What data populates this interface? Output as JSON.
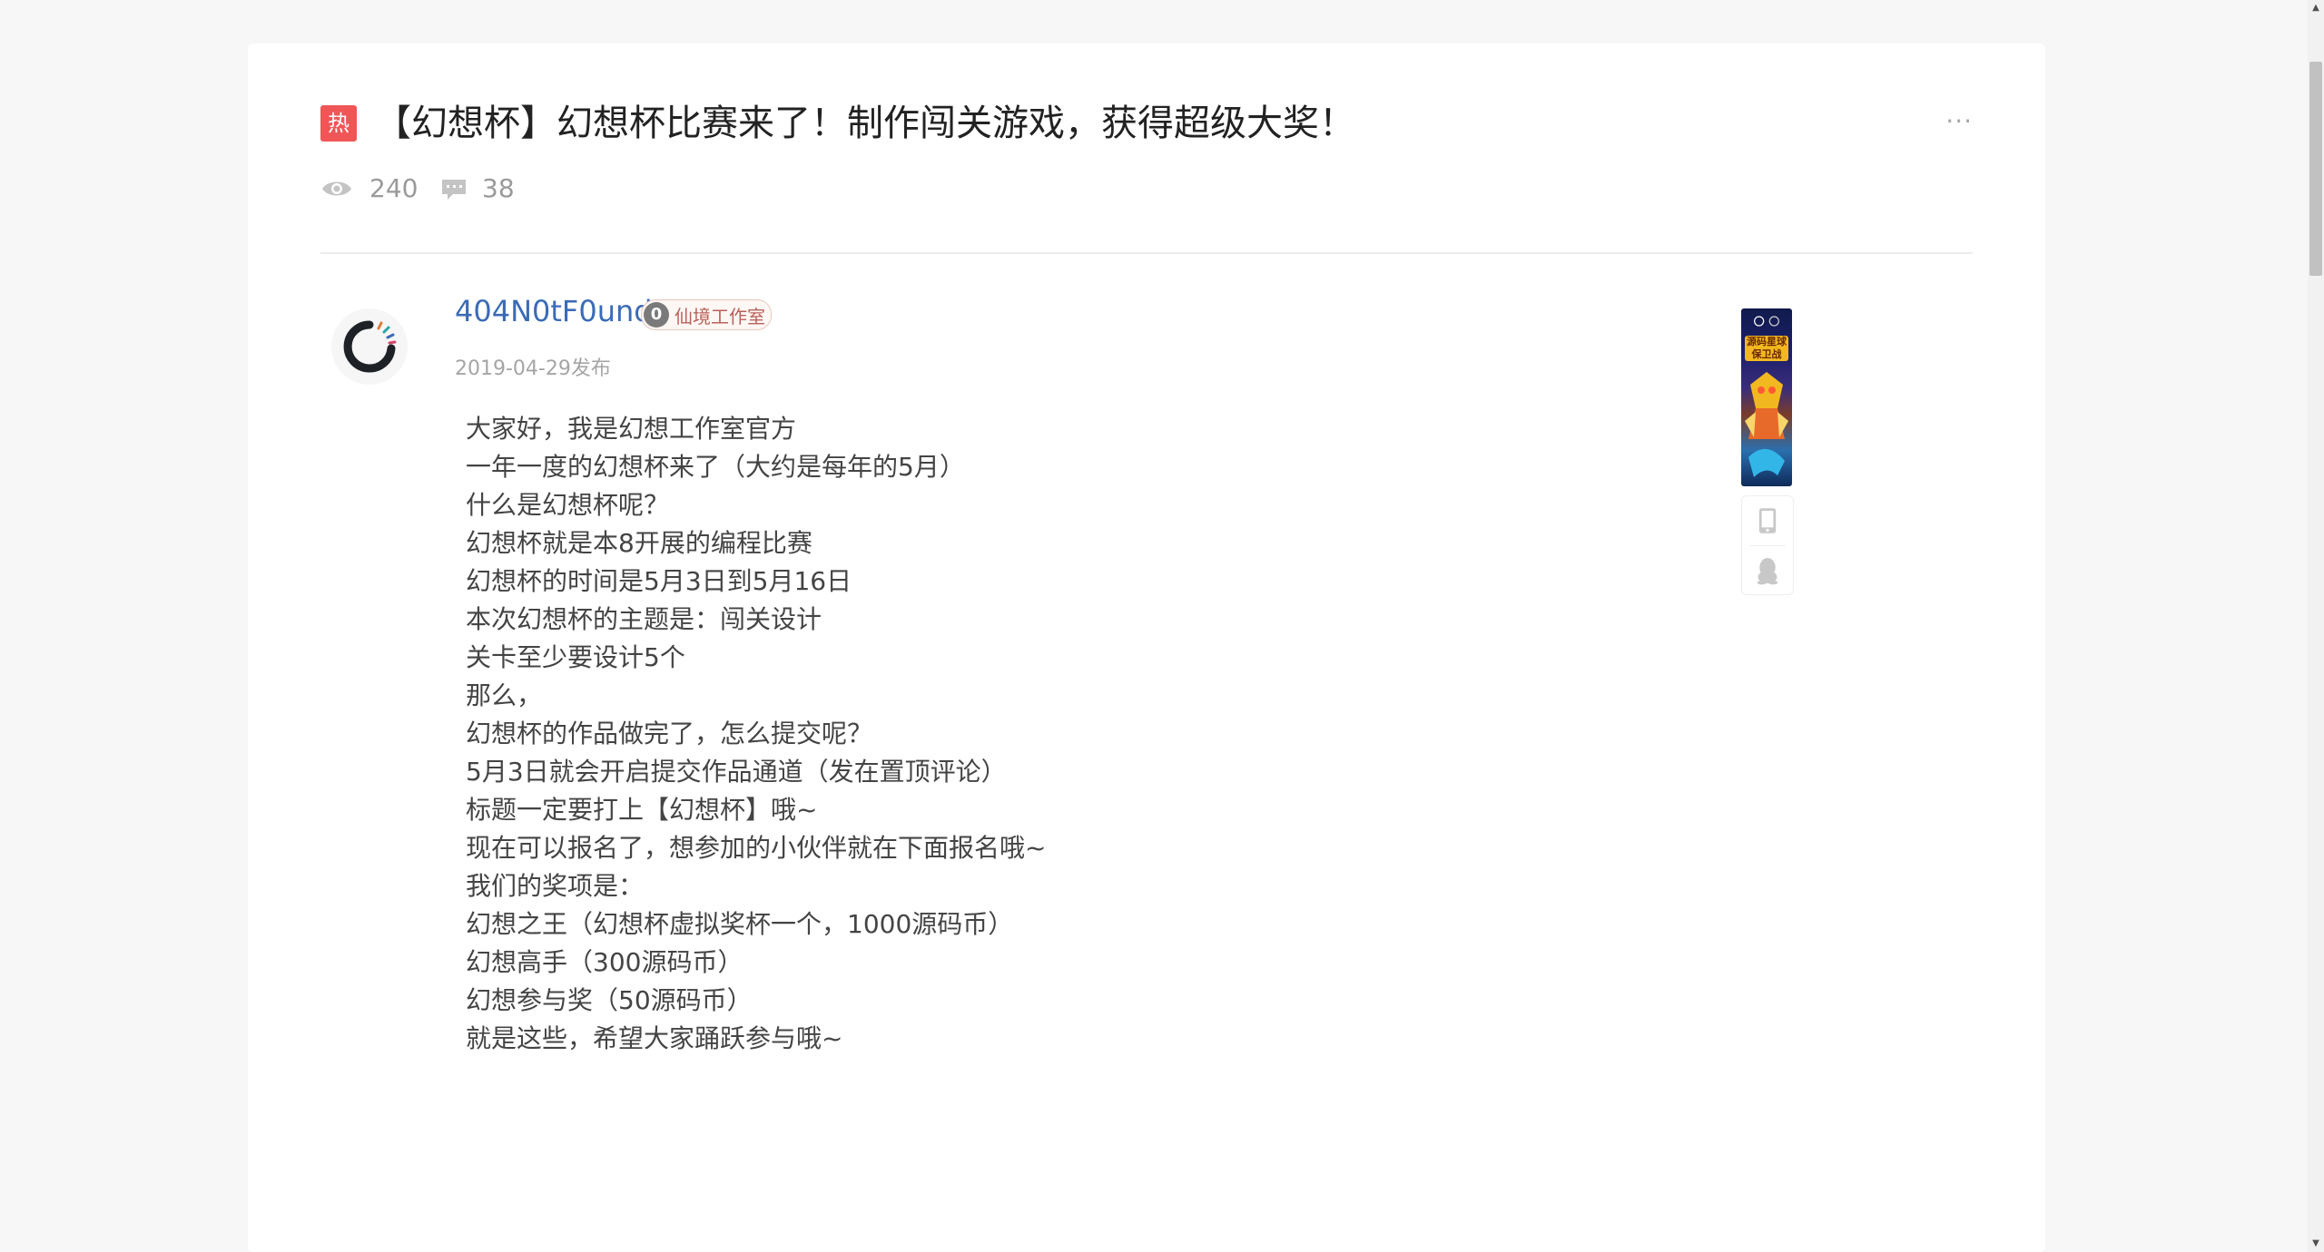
{
  "post": {
    "hot_label": "热",
    "title": "【幻想杯】幻想杯比赛来了！制作闯关游戏，获得超级大奖！",
    "more_label": "···",
    "views": "240",
    "comments": "38"
  },
  "author": {
    "name": "404N0tF0und",
    "level": "0",
    "team": "仙境工作室",
    "published": "2019-04-29发布"
  },
  "body": {
    "lines": [
      "大家好，我是幻想工作室官方",
      "一年一度的幻想杯来了（大约是每年的5月）",
      "什么是幻想杯呢？",
      "幻想杯就是本8开展的编程比赛",
      "幻想杯的时间是5月3日到5月16日",
      "本次幻想杯的主题是：闯关设计",
      "关卡至少要设计5个",
      "那么，",
      "幻想杯的作品做完了，怎么提交呢？",
      "5月3日就会开启提交作品通道（发在置顶评论）",
      "标题一定要打上【幻想杯】哦~",
      "现在可以报名了，想参加的小伙伴就在下面报名哦~",
      "我们的奖项是：",
      "幻想之王（幻想杯虚拟奖杯一个，1000源码币）",
      "幻想高手（300源码币）",
      "幻想参与奖（50源码币）",
      "就是这些，希望大家踊跃参与哦~"
    ]
  },
  "sidebar": {
    "ad_text": "源码星球 保卫战"
  },
  "icons": {
    "views": "eye-icon",
    "comments": "comment-icon",
    "app": "phone-icon",
    "qq": "qq-icon"
  },
  "colors": {
    "hot": "#f05656",
    "author": "#3b6bb6",
    "text": "#444444"
  }
}
